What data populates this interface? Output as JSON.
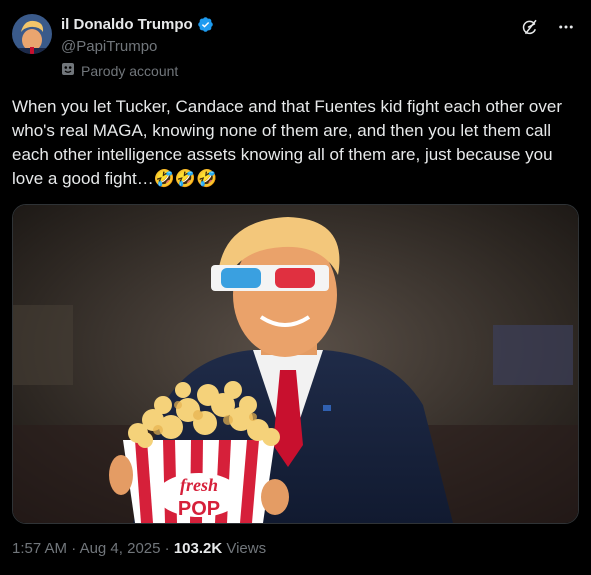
{
  "author": {
    "display_name": "il Donaldo Trumpo",
    "handle": "@PapiTrumpo",
    "label": "Parody account"
  },
  "tweet": {
    "text": "When you let Tucker, Candace and that Fuentes kid fight each other over who's real MAGA, knowing none of them are, and then you let them call each other intelligence assets knowing all of them are, just because you love a good fight…🤣🤣🤣"
  },
  "meta": {
    "time": "1:57 AM",
    "date": "Aug 4, 2025",
    "views_count": "103.2K",
    "views_label": "Views"
  },
  "media": {
    "popcorn_text_1": "fresh",
    "popcorn_text_2": "POP"
  },
  "colors": {
    "background": "#000000",
    "text": "#e7e9ea",
    "muted": "#71767b",
    "verified": "#1d9bf0"
  }
}
